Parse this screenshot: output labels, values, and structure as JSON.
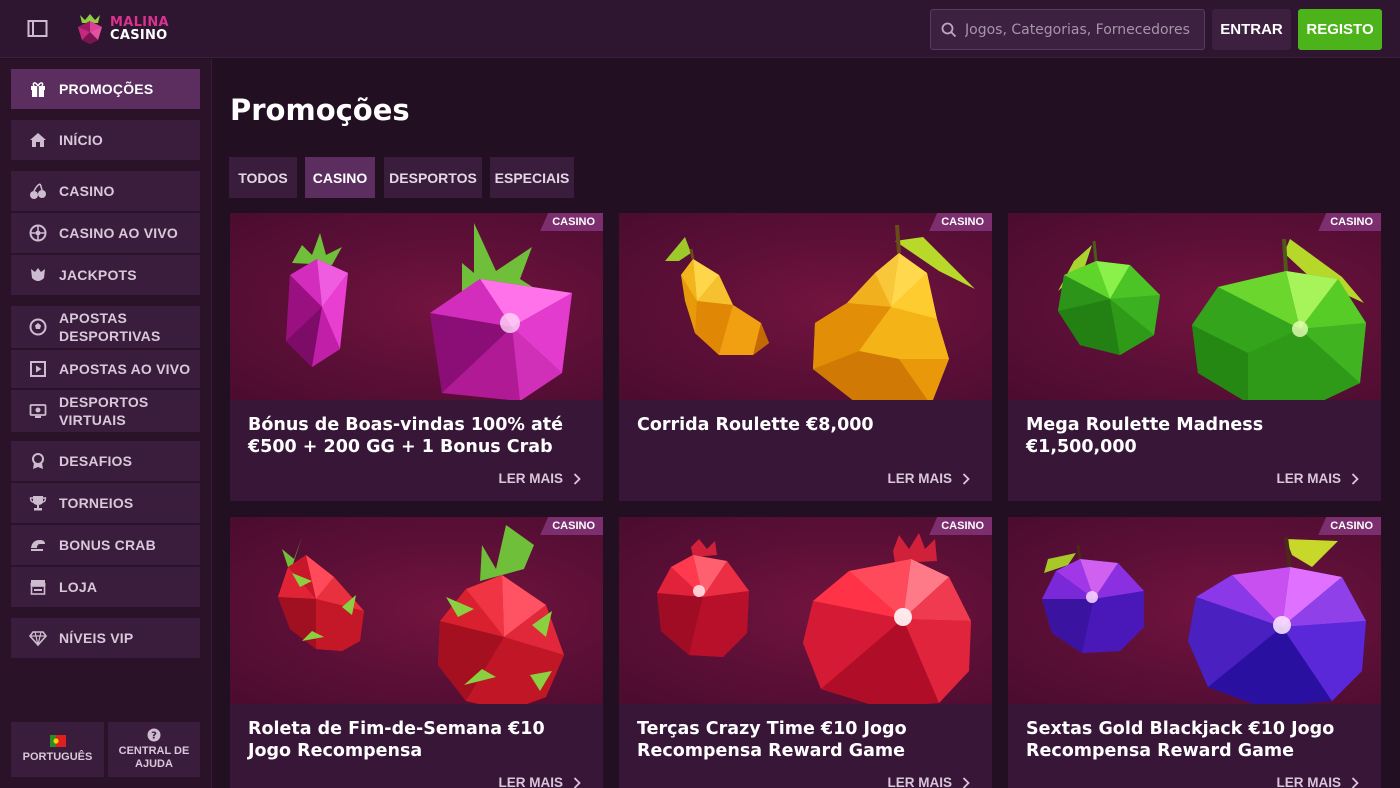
{
  "brand": {
    "line1": "MALINA",
    "line2": "CASINO"
  },
  "header": {
    "search_placeholder": "Jogos, Categorias, Fornecedores",
    "login_label": "ENTRAR",
    "register_label": "REGISTO"
  },
  "sidebar": {
    "items": [
      {
        "label": "PROMOÇÕES",
        "icon": "gift-icon",
        "active": true
      },
      {
        "label": "INÍCIO",
        "icon": "home-icon"
      },
      {
        "label": "CASINO",
        "icon": "cherries-icon"
      },
      {
        "label": "CASINO AO VIVO",
        "icon": "roulette-icon"
      },
      {
        "label": "JACKPOTS",
        "icon": "jackpot-icon"
      },
      {
        "label": "APOSTAS DESPORTIVAS",
        "icon": "football-icon"
      },
      {
        "label": "APOSTAS AO VIVO",
        "icon": "live-bet-icon"
      },
      {
        "label": "DESPORTOS VIRTUAIS",
        "icon": "virtual-sports-icon"
      },
      {
        "label": "DESAFIOS",
        "icon": "badge-icon"
      },
      {
        "label": "TORNEIOS",
        "icon": "trophy-icon"
      },
      {
        "label": "BONUS CRAB",
        "icon": "crab-icon"
      },
      {
        "label": "LOJA",
        "icon": "shop-icon"
      },
      {
        "label": "NÍVEIS VIP",
        "icon": "diamond-icon"
      }
    ],
    "language_label": "PORTUGUÊS",
    "help_label": "CENTRAL DE AJUDA"
  },
  "main": {
    "title": "Promoções",
    "tabs": [
      {
        "label": "TODOS"
      },
      {
        "label": "CASINO",
        "active": true
      },
      {
        "label": "DESPORTOS"
      },
      {
        "label": "ESPECIAIS"
      }
    ],
    "read_more_label": "LER MAIS",
    "cards": [
      {
        "title": "Bónus de Boas-vindas 100% até €500 + 200 GG + 1 Bonus Crab",
        "badge": "CASINO",
        "fruit": "raspberry-illustration"
      },
      {
        "title": "Corrida Roulette €8,000",
        "badge": "CASINO",
        "fruit": "pear-illustration"
      },
      {
        "title": "Mega Roulette Madness €1,500,000",
        "badge": "CASINO",
        "fruit": "apple-illustration"
      },
      {
        "title": "Roleta de Fim-de-Semana €10 Jogo Recompensa",
        "badge": "CASINO",
        "fruit": "dragonfruit-illustration"
      },
      {
        "title": "Terças Crazy Time €10 Jogo Recompensa Reward Game",
        "badge": "CASINO",
        "fruit": "pomegranate-illustration"
      },
      {
        "title": "Sextas Gold Blackjack €10 Jogo Recompensa Reward Game",
        "badge": "CASINO",
        "fruit": "plum-illustration"
      }
    ]
  },
  "colors": {
    "accent_green": "#4db31a",
    "active_purple": "#5b2e5f",
    "brand_pink": "#d7338f"
  }
}
